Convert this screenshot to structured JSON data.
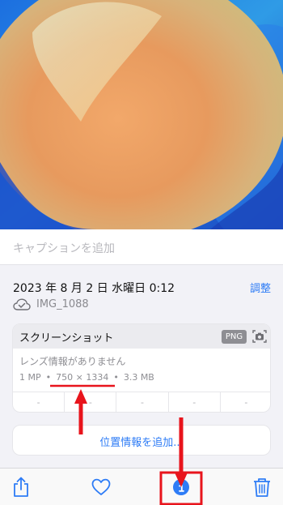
{
  "caption": {
    "placeholder": "キャプションを追加"
  },
  "info": {
    "datetime": "2023 年 8 月 2 日 水曜日 0:12",
    "adjust_label": "調整",
    "filename": "IMG_1088"
  },
  "card": {
    "title": "スクリーンショット",
    "format_badge": "PNG",
    "lens": "レンズ情報がありません",
    "megapixels": "1 MP",
    "separator": "•",
    "resolution": "750 × 1334",
    "filesize": "3.3 MB",
    "exif": [
      "-",
      "-",
      "-",
      "-",
      "-"
    ]
  },
  "location": {
    "add_label": "位置情報を追加..."
  },
  "toolbar": {
    "items": [
      "share-icon",
      "heart-icon",
      "info-icon",
      "trash-icon"
    ]
  },
  "colors": {
    "accent": "#2e7cf6",
    "annotation": "#e8141c"
  }
}
